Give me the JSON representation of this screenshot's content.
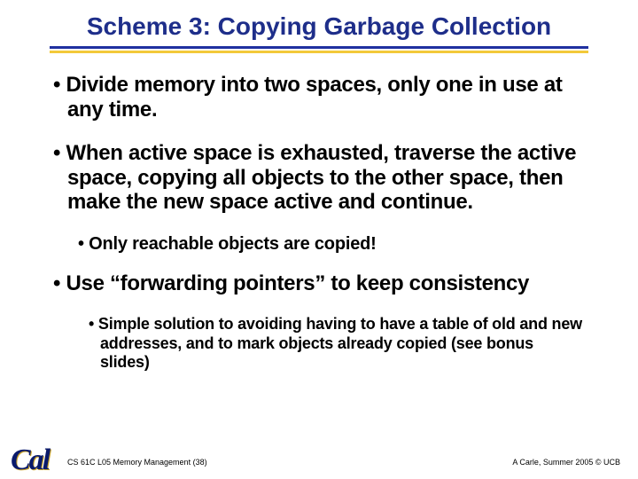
{
  "title": "Scheme 3: Copying Garbage Collection",
  "bullets": {
    "b1": "Divide memory into two spaces, only one in use at any time.",
    "b2": "When active space is exhausted, traverse the active space, copying all objects to the other space, then make the new space active and continue.",
    "b2a": "Only reachable objects are copied!",
    "b3": "Use “forwarding pointers” to keep consistency",
    "b3a": "Simple solution to avoiding having to have a table of old and new addresses, and to mark objects already copied (see bonus slides)"
  },
  "footer": {
    "left": "CS 61C L05 Memory Management (38)",
    "right": "A Carle, Summer 2005 © UCB"
  },
  "logo": {
    "text": "Cal"
  },
  "bullet_char": "•"
}
